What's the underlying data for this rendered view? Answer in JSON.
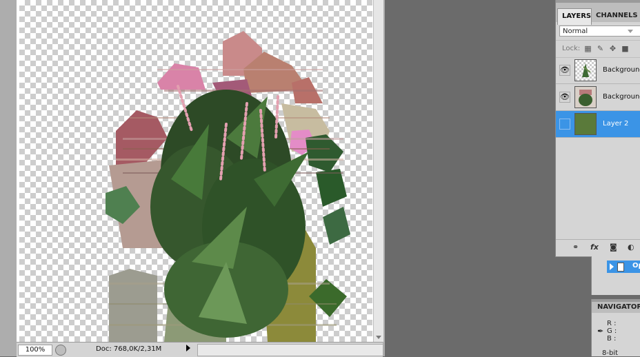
{
  "document": {
    "zoom": "100%",
    "doc_size": "Doc: 768,0K/2,31M"
  },
  "layers_panel": {
    "tabs": [
      "LAYERS",
      "CHANNELS"
    ],
    "blend_mode": "Normal",
    "lock_label": "Lock:",
    "layers": [
      {
        "name": "Background",
        "visible": true,
        "selected": false,
        "thumb": "plant-transparent"
      },
      {
        "name": "Background",
        "visible": true,
        "selected": false,
        "thumb": "plant-original"
      },
      {
        "name": "Layer 2",
        "visible": false,
        "selected": true,
        "thumb": "solid-green",
        "fill": "#5a7a3a"
      }
    ]
  },
  "actions": {
    "item_label": "Op"
  },
  "navigator": {
    "tab_label": "NAVIGATOR",
    "info": [
      "R :",
      "G :",
      "B :"
    ],
    "bit_depth": "8-bit"
  },
  "colors": {
    "selection": "#3b94e6",
    "panel_bg": "#d5d5d5",
    "workspace": "#6b6b6b"
  }
}
